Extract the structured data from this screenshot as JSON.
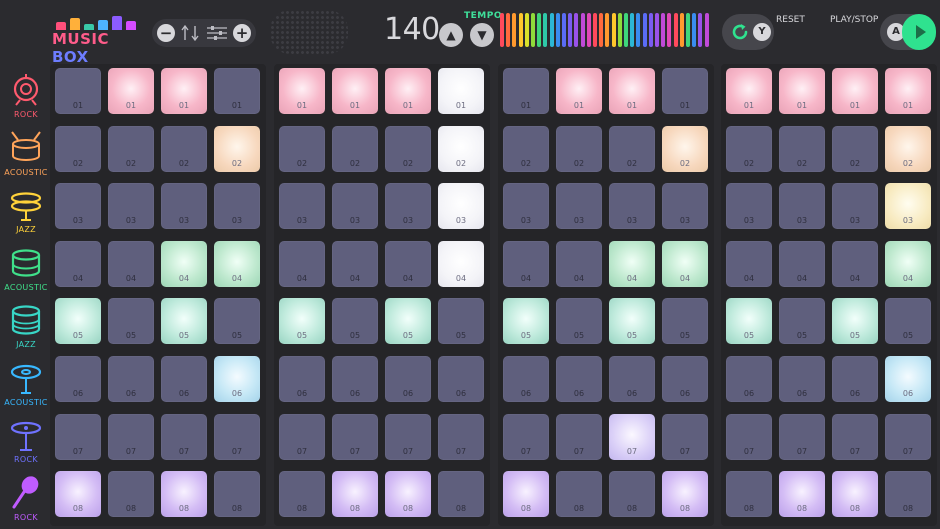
{
  "app": {
    "logo_word1": "MUSIC",
    "logo_word2": "BOX",
    "logo_bar_colors": [
      "#ff4f7b",
      "#ffb03a",
      "#39c9a8",
      "#4db4ff",
      "#8c5cff",
      "#d64cff"
    ]
  },
  "volume": {
    "minus_label": "−",
    "plus_label": "+"
  },
  "tempo": {
    "value": "140",
    "label": "TEMPO",
    "up_label": "▲",
    "down_label": "▼",
    "meter_colors": [
      "#ff4a5c",
      "#ff6a3d",
      "#ff9a2e",
      "#ffc72c",
      "#d9e02b",
      "#8fdc3a",
      "#3fd67a",
      "#2ec9a8",
      "#2cb7d6",
      "#3a8cf0",
      "#5a6cf5",
      "#7a5cf2",
      "#9a52ea",
      "#c04ad8",
      "#e048b8",
      "#ff4a5c",
      "#ff6a3d",
      "#ff9a2e",
      "#ffc72c",
      "#8fdc3a",
      "#3fd67a",
      "#2cb7d6",
      "#3a8cf0",
      "#5a6cf5",
      "#7a5cf2",
      "#9a52ea",
      "#c04ad8",
      "#e048b8",
      "#ff4a5c",
      "#ff9a2e",
      "#3fd67a",
      "#3a8cf0",
      "#9a52ea",
      "#c04ad8"
    ]
  },
  "controls": {
    "reset_label": "RESET",
    "reset_key": "Y",
    "play_label": "PLAY/STOP",
    "play_key": "A",
    "accent_color": "#2fe28f"
  },
  "instruments": [
    {
      "label": "ROCK",
      "icon": "rock-drum-icon",
      "color": "#ff5a6e"
    },
    {
      "label": "ACOUSTIC",
      "icon": "snare-drum-icon",
      "color": "#ffa45a"
    },
    {
      "label": "JAZZ",
      "icon": "cymbal-icon",
      "color": "#ffd23a"
    },
    {
      "label": "ACOUSTIC",
      "icon": "tom-drum-icon",
      "color": "#3fe08a"
    },
    {
      "label": "JAZZ",
      "icon": "floor-tom-icon",
      "color": "#38d6c6"
    },
    {
      "label": "ACOUSTIC",
      "icon": "hihat-icon",
      "color": "#38b8ff"
    },
    {
      "label": "ROCK",
      "icon": "crash-cymbal-icon",
      "color": "#6f72ff"
    },
    {
      "label": "ROCK",
      "icon": "maraca-icon",
      "color": "#c05cff"
    }
  ],
  "row_numbers": [
    "01",
    "02",
    "03",
    "04",
    "05",
    "06",
    "07",
    "08"
  ],
  "row_colors": [
    "pink",
    "peach",
    "cream",
    "green",
    "mint",
    "blue",
    "lav",
    "violet"
  ],
  "panels": [
    {
      "rows": [
        [
          0,
          1,
          1,
          0
        ],
        [
          0,
          0,
          0,
          1
        ],
        [
          0,
          0,
          0,
          0
        ],
        [
          0,
          0,
          1,
          1
        ],
        [
          1,
          0,
          1,
          0
        ],
        [
          0,
          0,
          0,
          1
        ],
        [
          0,
          0,
          0,
          0
        ],
        [
          1,
          0,
          1,
          0
        ]
      ]
    },
    {
      "rows": [
        [
          1,
          1,
          1,
          "w"
        ],
        [
          0,
          0,
          0,
          "w"
        ],
        [
          0,
          0,
          0,
          "w"
        ],
        [
          0,
          0,
          0,
          "w"
        ],
        [
          1,
          0,
          1,
          0
        ],
        [
          0,
          0,
          0,
          0
        ],
        [
          0,
          0,
          0,
          0
        ],
        [
          0,
          1,
          1,
          0
        ]
      ]
    },
    {
      "rows": [
        [
          0,
          1,
          1,
          0
        ],
        [
          0,
          0,
          0,
          1
        ],
        [
          0,
          0,
          0,
          0
        ],
        [
          0,
          0,
          1,
          1
        ],
        [
          1,
          0,
          1,
          0
        ],
        [
          0,
          0,
          0,
          0
        ],
        [
          0,
          0,
          1,
          0
        ],
        [
          1,
          0,
          0,
          1
        ]
      ]
    },
    {
      "rows": [
        [
          1,
          1,
          1,
          1
        ],
        [
          0,
          0,
          0,
          1
        ],
        [
          0,
          0,
          0,
          1
        ],
        [
          0,
          0,
          0,
          1
        ],
        [
          1,
          0,
          1,
          0
        ],
        [
          0,
          0,
          0,
          1
        ],
        [
          0,
          0,
          0,
          0
        ],
        [
          0,
          1,
          1,
          0
        ]
      ]
    }
  ]
}
